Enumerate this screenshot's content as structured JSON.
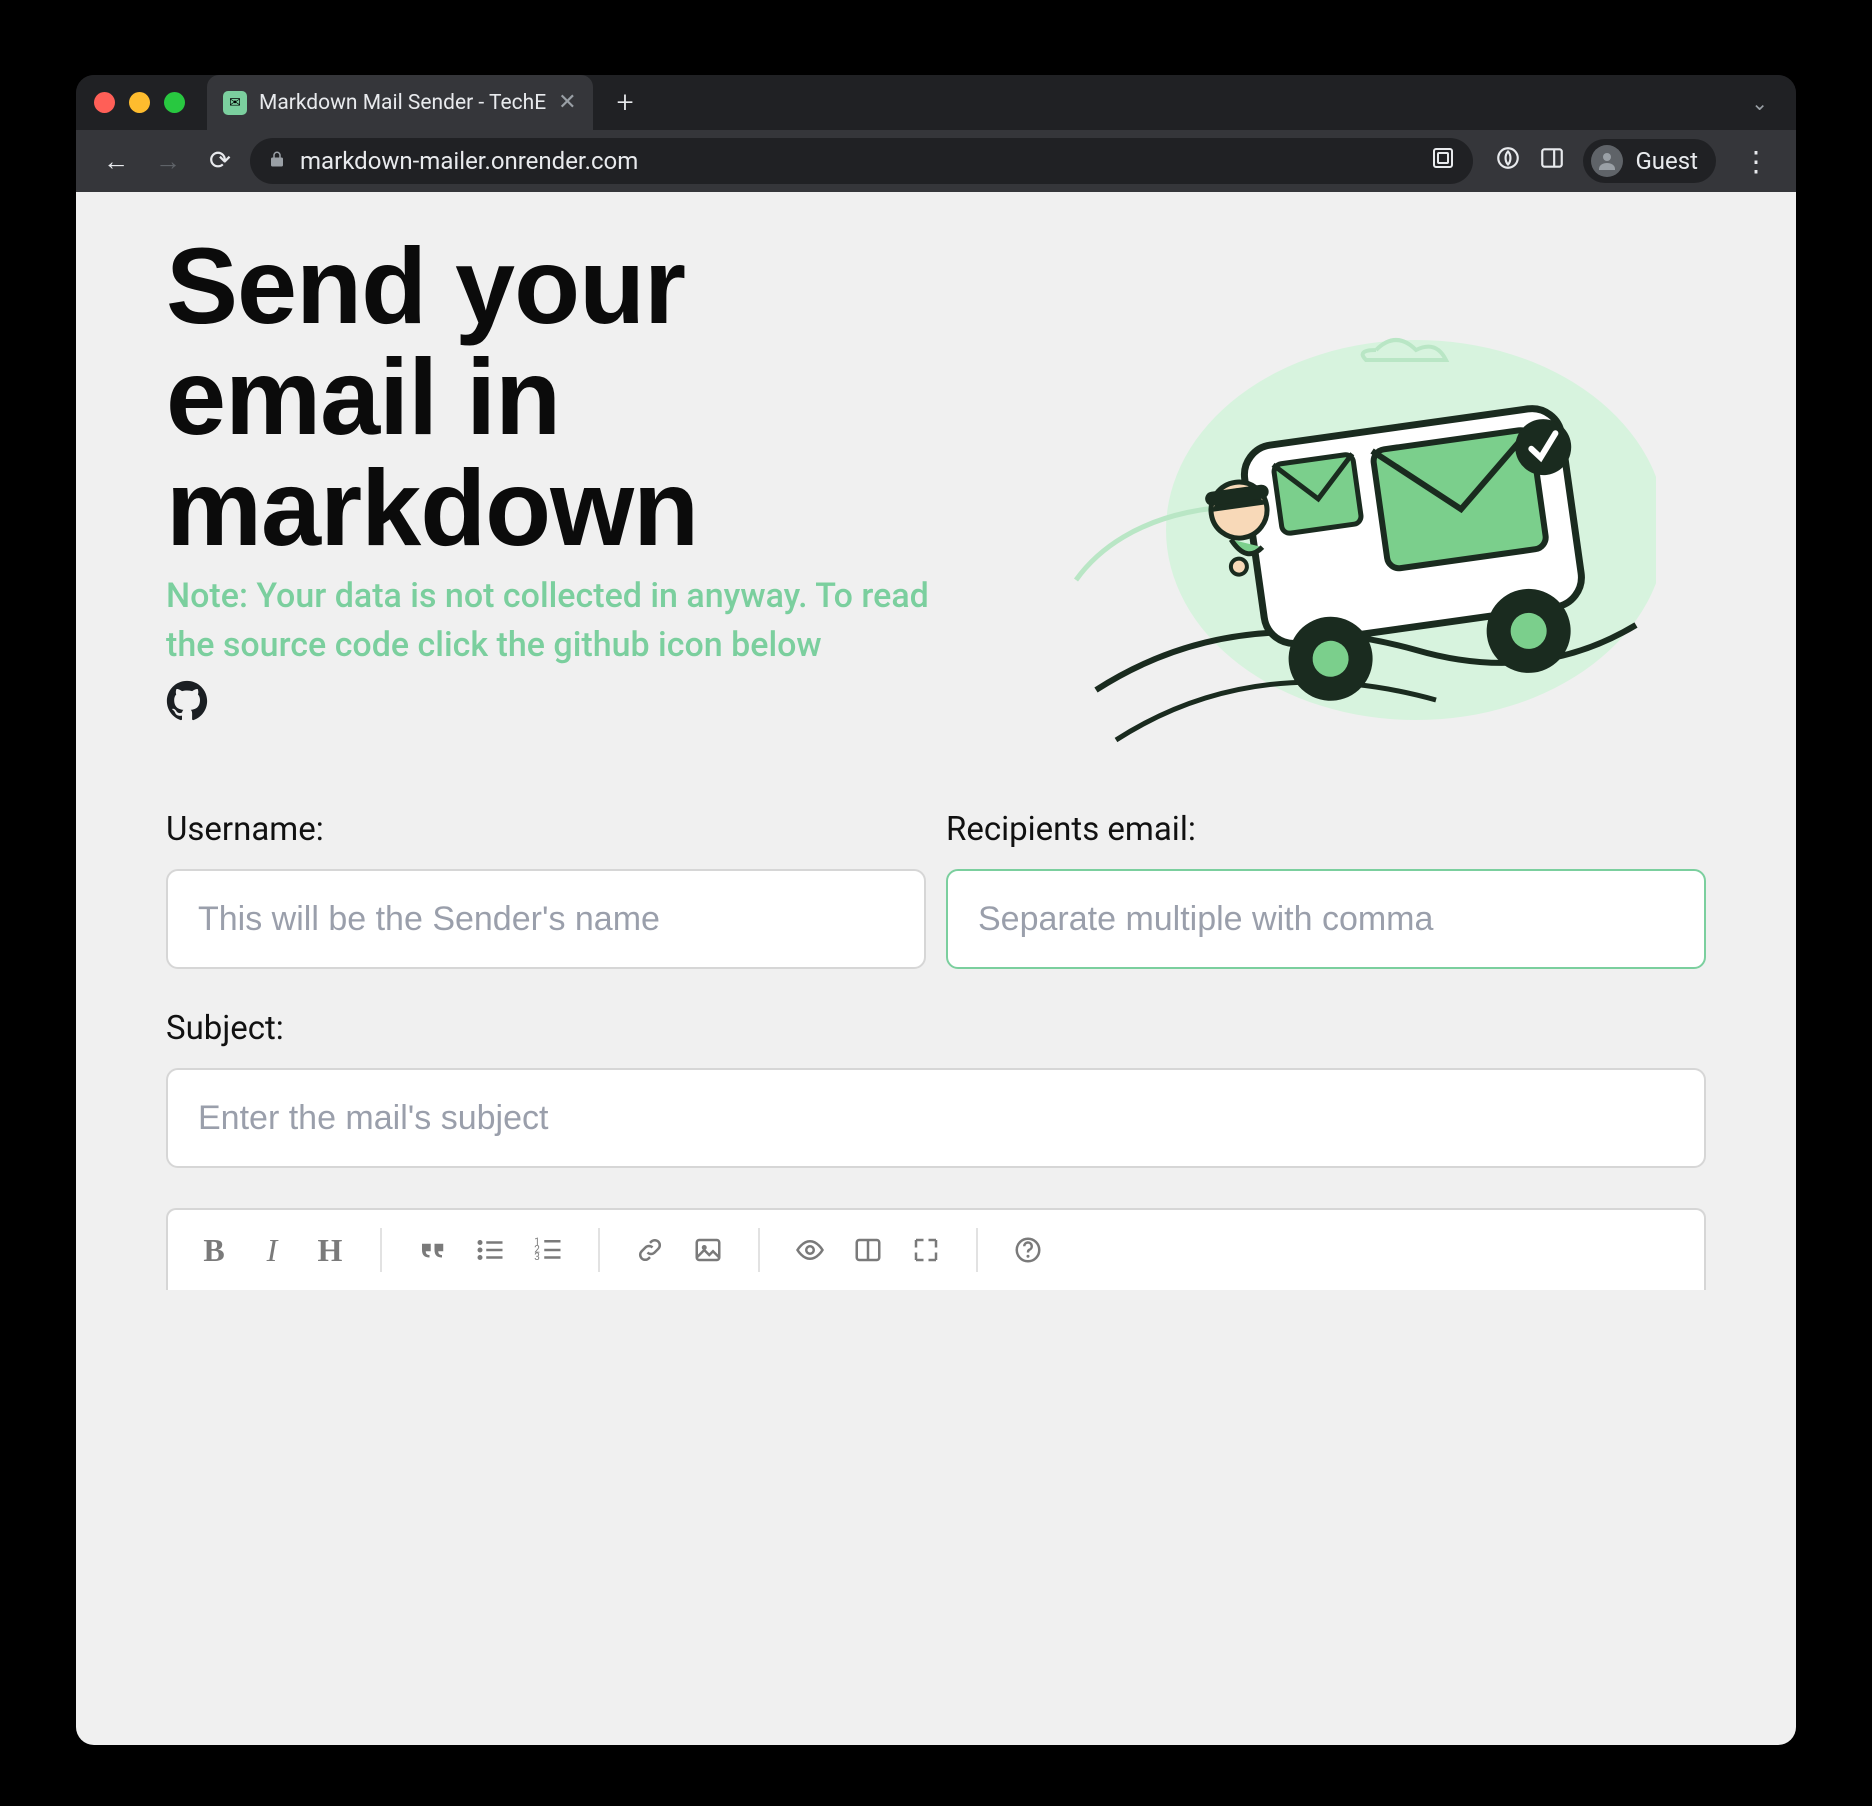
{
  "browser": {
    "tab_title": "Markdown Mail Sender - TechE",
    "url": "markdown-mailer.onrender.com",
    "guest_label": "Guest"
  },
  "hero": {
    "title": "Send your email in markdown",
    "note": "Note: Your data is not collected in anyway. To read the source code click the github icon below"
  },
  "form": {
    "username_label": "Username:",
    "username_placeholder": "This will be the Sender's name",
    "recipients_label": "Recipients email:",
    "recipients_placeholder": "Separate multiple with comma",
    "subject_label": "Subject:",
    "subject_placeholder": "Enter the mail's subject"
  },
  "toolbar": {
    "bold": "B",
    "italic": "I",
    "heading": "H"
  }
}
